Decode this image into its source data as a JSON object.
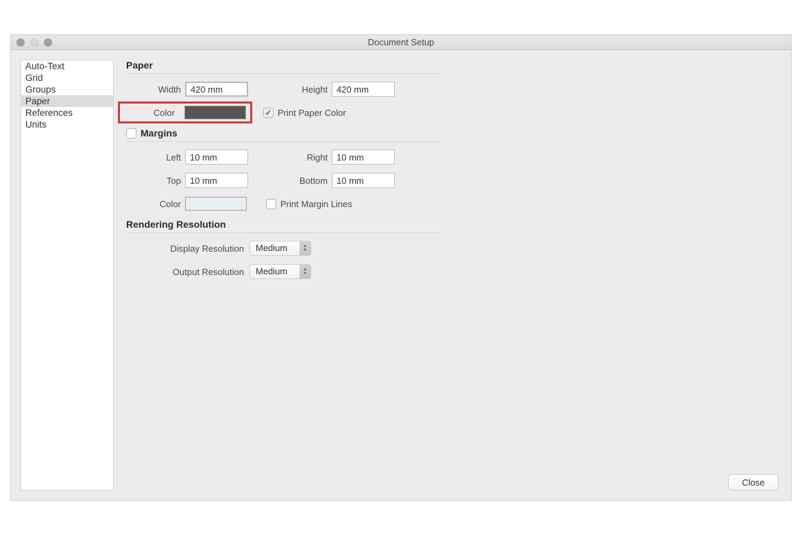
{
  "window": {
    "title": "Document Setup"
  },
  "sidebar": {
    "items": [
      {
        "label": "Auto-Text",
        "selected": false
      },
      {
        "label": "Grid",
        "selected": false
      },
      {
        "label": "Groups",
        "selected": false
      },
      {
        "label": "Paper",
        "selected": true
      },
      {
        "label": "References",
        "selected": false
      },
      {
        "label": "Units",
        "selected": false
      }
    ]
  },
  "paper": {
    "header": "Paper",
    "width_label": "Width",
    "width_value": "420 mm",
    "height_label": "Height",
    "height_value": "420 mm",
    "color_label": "Color",
    "color_value": "#555555",
    "print_paper_color_checked": true,
    "print_paper_color_label": "Print Paper Color"
  },
  "margins": {
    "header": "Margins",
    "enabled": false,
    "left_label": "Left",
    "left_value": "10 mm",
    "right_label": "Right",
    "right_value": "10 mm",
    "top_label": "Top",
    "top_value": "10 mm",
    "bottom_label": "Bottom",
    "bottom_value": "10 mm",
    "color_label": "Color",
    "color_value": "#e6f0f0",
    "print_margin_lines_checked": false,
    "print_margin_lines_label": "Print Margin Lines"
  },
  "rendering": {
    "header": "Rendering Resolution",
    "display_label": "Display Resolution",
    "display_value": "Medium",
    "output_label": "Output Resolution",
    "output_value": "Medium"
  },
  "footer": {
    "close_label": "Close"
  }
}
